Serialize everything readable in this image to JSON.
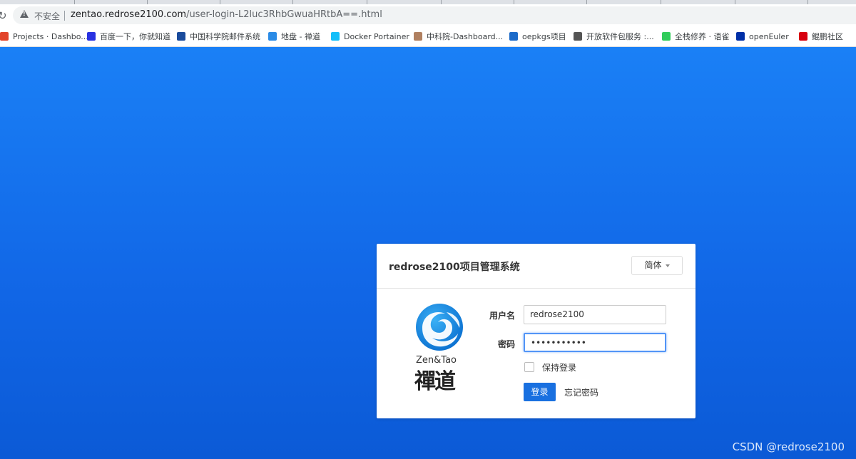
{
  "browser": {
    "security_label": "不安全",
    "url_host": "zentao.redrose2100.com",
    "url_path": "/user-login-L2luc3RhbGwuaHRtbA==.html",
    "bookmarks": [
      {
        "label": "Projects · Dashbo...",
        "icon": "gitlab-icon",
        "color": "#e24329"
      },
      {
        "label": "百度一下，你就知道",
        "icon": "baidu-icon",
        "color": "#2932e1"
      },
      {
        "label": "中国科学院邮件系统",
        "icon": "mail-icon",
        "color": "#1a4b9c"
      },
      {
        "label": "地盘 - 禅道",
        "icon": "zentao-icon",
        "color": "#2b8be6"
      },
      {
        "label": "Docker Portainer",
        "icon": "portainer-icon",
        "color": "#13bef9"
      },
      {
        "label": "中科院-Dashboard...",
        "icon": "avatar-icon",
        "color": "#b08060"
      },
      {
        "label": "oepkgs项目",
        "icon": "link-icon",
        "color": "#1b6ac9"
      },
      {
        "label": "开放软件包服务 :...",
        "icon": "globe-icon",
        "color": "#555555"
      },
      {
        "label": "全栈修养 · 语雀",
        "icon": "yuque-icon",
        "color": "#31cc5b"
      },
      {
        "label": "openEuler",
        "icon": "openeuler-icon",
        "color": "#002fa7"
      },
      {
        "label": "鲲鹏社区",
        "icon": "kunpeng-icon",
        "color": "#d7000f"
      }
    ]
  },
  "login": {
    "title": "redrose2100项目管理系统",
    "lang_label": "简体",
    "logo_text": "Zen&Tao",
    "logo_chinese": "禪道",
    "username_label": "用户名",
    "username_value": "redrose2100",
    "password_label": "密码",
    "password_value": "•••••••••••",
    "remember_label": "保持登录",
    "login_label": "登录",
    "forgot_label": "忘记密码"
  },
  "watermark": "CSDN @redrose2100",
  "colors": {
    "background_start": "#1a80f6",
    "background_end": "#0a58d6",
    "primary": "#1970e0"
  }
}
